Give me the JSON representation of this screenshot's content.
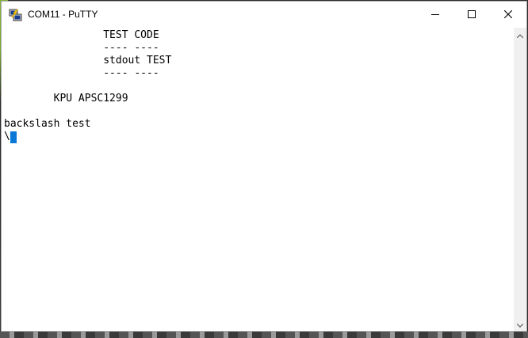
{
  "window": {
    "title": "COM11 - PuTTY",
    "app_icon": "putty-icon",
    "controls": [
      "minimize-icon",
      "maximize-icon",
      "close-icon"
    ]
  },
  "terminal": {
    "lines": [
      "                TEST CODE",
      "                ---- ----",
      "                stdout TEST",
      "                ---- ----",
      "",
      "        KPU APSC1299",
      "",
      "backslash test",
      "\\"
    ],
    "cursor_color": "#0a78d7",
    "background": "#ffffff",
    "foreground": "#000000"
  },
  "scrollbar": {
    "icons": [
      "scroll-up-icon",
      "scroll-down-icon"
    ]
  }
}
